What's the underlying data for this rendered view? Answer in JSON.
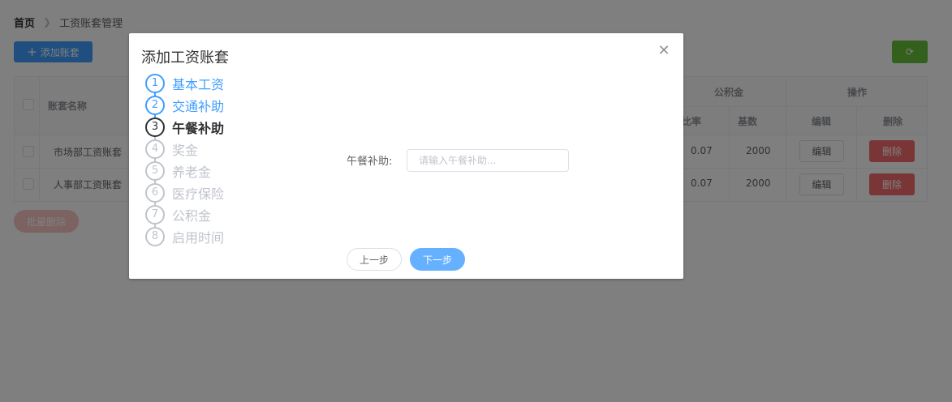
{
  "breadcrumb": {
    "home": "首页",
    "separator": ">",
    "current": "工资账套管理"
  },
  "toolbar": {
    "add_label": "添加账套",
    "add_icon": "plus-icon",
    "refresh_icon": "refresh-icon"
  },
  "table": {
    "headers": {
      "name": "账套名称",
      "gjj_group": "公积金",
      "actions_group": "操作",
      "rate_partial": "比率",
      "base": "基数",
      "edit": "编辑",
      "delete": "删除"
    },
    "rows": [
      {
        "name": "市场部工资账套",
        "rate": "0.07",
        "base": "2000",
        "edit": "编辑",
        "delete": "删除"
      },
      {
        "name": "人事部工资账套",
        "rate": "0.07",
        "base": "2000",
        "edit": "编辑",
        "delete": "删除"
      }
    ]
  },
  "batch_delete_label": "批量删除",
  "dialog": {
    "title": "添加工资账套",
    "close_icon": "close-icon",
    "steps": [
      {
        "num": "1",
        "label": "基本工资",
        "status": "done"
      },
      {
        "num": "2",
        "label": "交通补助",
        "status": "done"
      },
      {
        "num": "3",
        "label": "午餐补助",
        "status": "active"
      },
      {
        "num": "4",
        "label": "奖金",
        "status": "wait"
      },
      {
        "num": "5",
        "label": "养老金",
        "status": "wait"
      },
      {
        "num": "6",
        "label": "医疗保险",
        "status": "wait"
      },
      {
        "num": "7",
        "label": "公积金",
        "status": "wait"
      },
      {
        "num": "8",
        "label": "启用时间",
        "status": "wait"
      }
    ],
    "field_label": "午餐补助:",
    "field_value": "",
    "field_placeholder": "请输入午餐补助...",
    "prev_label": "上一步",
    "next_label": "下一步"
  },
  "colors": {
    "primary": "#409eff",
    "success": "#67c23a",
    "danger": "#f56c6c",
    "inactive": "#c0c4cc"
  }
}
